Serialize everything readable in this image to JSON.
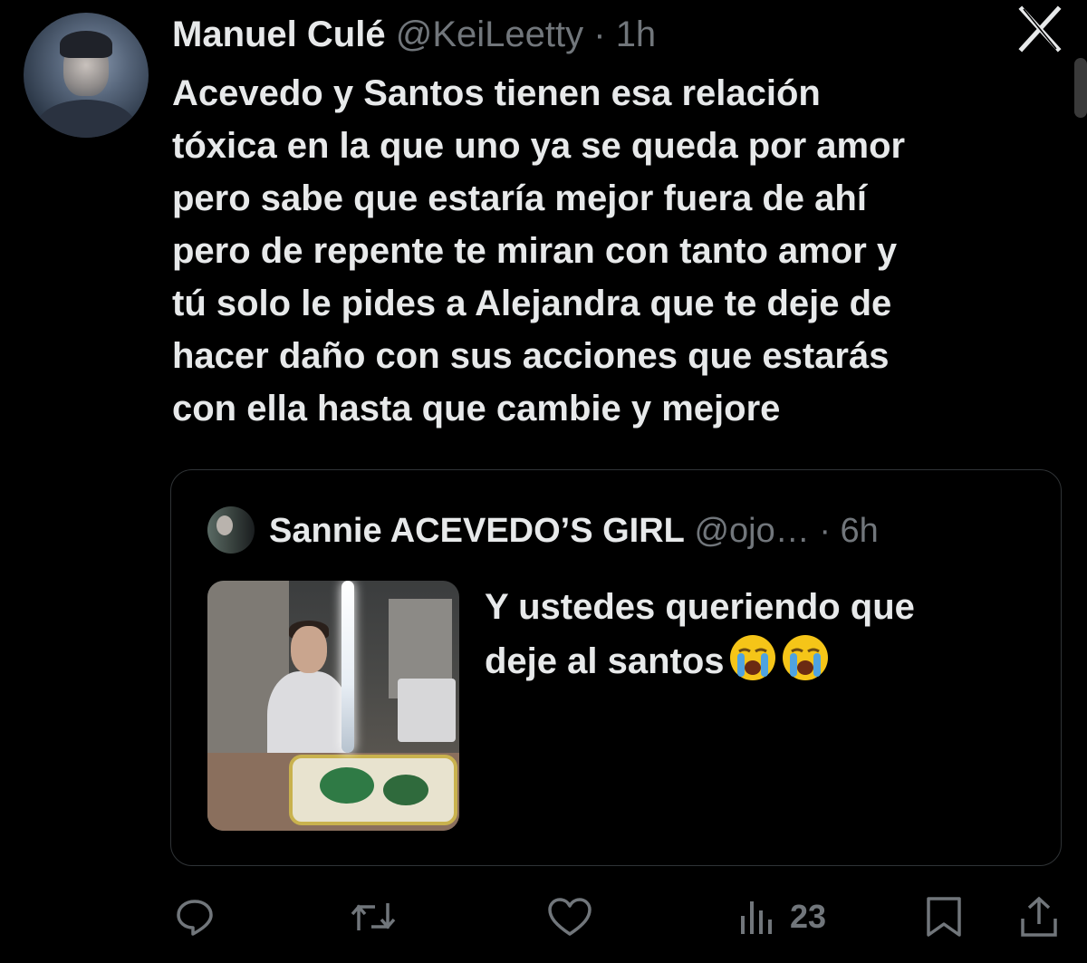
{
  "tweet": {
    "author_name": "Manuel Culé",
    "handle": "@KeiLeetty",
    "separator": "·",
    "time": "1h",
    "text_lines": [
      "Acevedo y Santos tienen esa relación",
      "tóxica en la que uno ya se queda por amor",
      "pero sabe que estaría mejor fuera de ahí",
      "pero de repente te miran con tanto amor y",
      "tú solo le pides a Alejandra que te deje de",
      "hacer daño con sus acciones que estarás",
      "con ella hasta que cambie y mejore"
    ]
  },
  "quote": {
    "author_name": "Sannie ACEVEDO’S GIRL",
    "handle": "@ojo…",
    "separator": "·",
    "time": "6h",
    "text_lines": [
      "Y ustedes queriendo que",
      "deje al santos"
    ]
  },
  "actions": {
    "views_count": "23"
  },
  "icons": {
    "close": "x-close-icon",
    "reply": "reply-icon",
    "retweet": "retweet-icon",
    "like": "heart-icon",
    "views": "views-icon",
    "bookmark": "bookmark-icon",
    "share": "share-icon",
    "emoji": "loudly-crying-face-icon"
  },
  "colors": {
    "background": "#000000",
    "text": "#e7e9ea",
    "secondary": "#71767b",
    "border": "#2f3336",
    "emoji": "#f5c518"
  }
}
